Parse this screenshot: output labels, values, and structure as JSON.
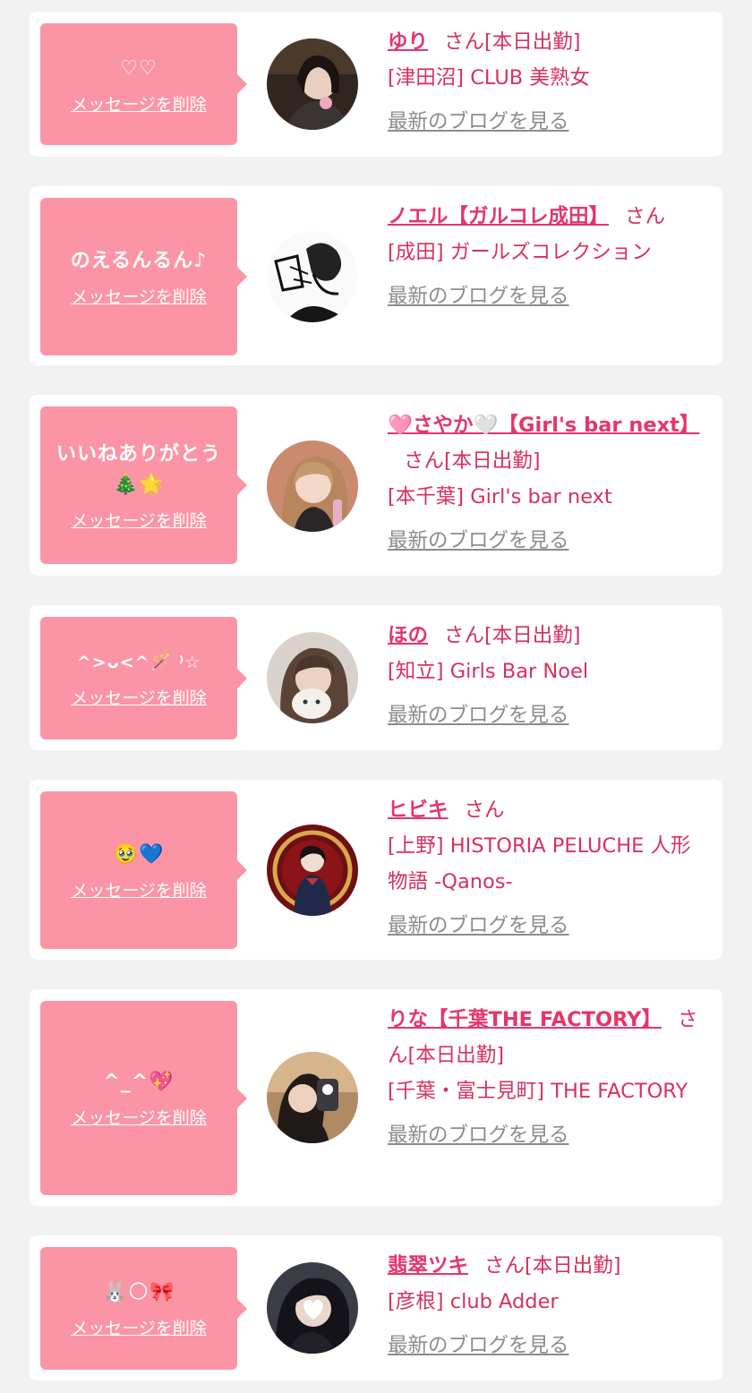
{
  "delete_label": "メッセージを削除",
  "blog_label": "最新のブログを見る",
  "honorific": "さん",
  "colors": {
    "page_bg": "#f2f2f2",
    "card_bg": "#ffffff",
    "bubble": "#fb95a6",
    "accent": "#e5356b",
    "muted": "#8c8c8c"
  },
  "messages": [
    {
      "message": "♡♡",
      "name": "ゆり",
      "suffix": "さん[本日出勤]",
      "store": "[津田沼] CLUB 美熟女",
      "avatar_icon": "profile-photo"
    },
    {
      "message": "のえるんるん♪",
      "name": "ノエル【ガルコレ成田】",
      "suffix": "さん",
      "store": "[成田] ガールズコレクション",
      "avatar_icon": "manga-illustration"
    },
    {
      "message": "いいねありがとう🎄🌟",
      "name": "🩷さやか🤍【Girl's bar next】",
      "suffix": "さん[本日出勤]",
      "store": "[本千葉] Girl's bar next",
      "avatar_icon": "profile-photo"
    },
    {
      "message": "^>ᴗ<^🪄 ⁾☆",
      "name": "ほの",
      "suffix": "さん[本日出勤]",
      "store": "[知立] Girls Bar Noel",
      "avatar_icon": "profile-photo"
    },
    {
      "message": "🥹💙",
      "name": "ヒビキ",
      "suffix": "さん",
      "store": "[上野] HISTORIA PELUCHE 人形物語 -Qanos-",
      "avatar_icon": "profile-photo"
    },
    {
      "message": "^_^💖",
      "name": "りな【千葉THE FACTORY】",
      "suffix": "さん[本日出勤]",
      "store": "[千葉・富士見町] THE FACTORY",
      "avatar_icon": "profile-photo"
    },
    {
      "message": "🐰🌕🎀",
      "name": "翡翠ツキ",
      "suffix": "さん[本日出勤]",
      "store": "[彦根] club Adder",
      "avatar_icon": "profile-photo"
    }
  ]
}
